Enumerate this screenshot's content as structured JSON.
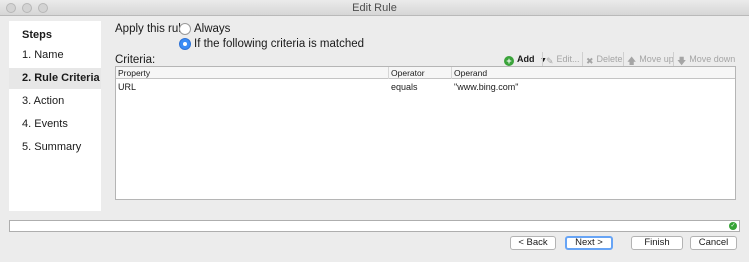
{
  "window": {
    "title": "Edit Rule"
  },
  "steps": {
    "heading": "Steps",
    "items": [
      {
        "label": "1. Name"
      },
      {
        "label": "2. Rule Criteria"
      },
      {
        "label": "3. Action"
      },
      {
        "label": "4. Events"
      },
      {
        "label": "5. Summary"
      }
    ],
    "active_index": 1
  },
  "apply": {
    "label": "Apply this rule:",
    "options": [
      {
        "label": "Always",
        "selected": false
      },
      {
        "label": "If the following criteria is matched",
        "selected": true
      }
    ]
  },
  "criteria": {
    "label": "Criteria:",
    "toolbar": {
      "add_label": "Add",
      "edit_label": "Edit...",
      "delete_label": "Delete",
      "move_up_label": "Move up",
      "move_down_label": "Move down"
    },
    "columns": [
      "Property",
      "Operator",
      "Operand"
    ],
    "rows": [
      {
        "property": "URL",
        "operator": "equals",
        "operand": "\"www.bing.com\""
      }
    ]
  },
  "buttons": {
    "back": "< Back",
    "next": "Next >",
    "finish": "Finish",
    "cancel": "Cancel"
  },
  "colors": {
    "accent": "#3a8cf6",
    "ok": "#35a335"
  }
}
